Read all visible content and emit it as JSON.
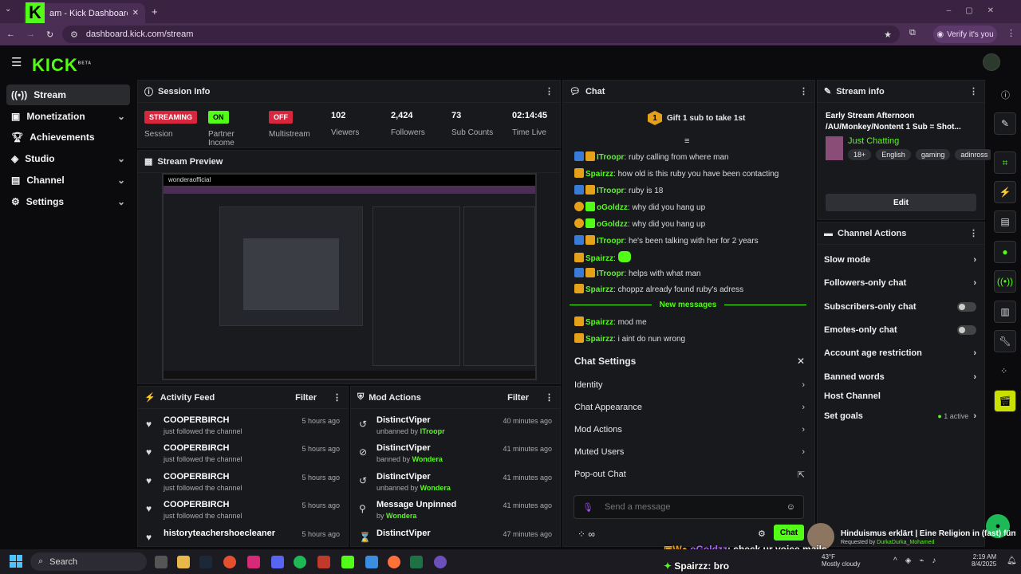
{
  "browser": {
    "tab_title": "am - Kick Dashboard",
    "url": "dashboard.kick.com/stream",
    "verify": "Verify it's you"
  },
  "brand": {
    "logo": "KICK",
    "beta": "BETA"
  },
  "sidebar": {
    "items": [
      {
        "label": "Stream",
        "icon": "stream-icon"
      },
      {
        "label": "Monetization",
        "icon": "money-icon"
      },
      {
        "label": "Achievements",
        "icon": "trophy-icon"
      },
      {
        "label": "Studio",
        "icon": "studio-icon"
      },
      {
        "label": "Channel",
        "icon": "channel-icon"
      },
      {
        "label": "Settings",
        "icon": "gear-icon"
      }
    ]
  },
  "session": {
    "title": "Session Info",
    "session_badge": "STREAMING",
    "session_label": "Session",
    "partner_badge": "ON",
    "partner_label": "Partner Income",
    "multi_badge": "OFF",
    "multi_label": "Multistream",
    "viewers": "102",
    "viewers_label": "Viewers",
    "followers": "2,424",
    "followers_label": "Followers",
    "subs": "73",
    "subs_label": "Sub Counts",
    "time": "02:14:45",
    "time_label": "Time Live"
  },
  "preview": {
    "title": "Stream Preview",
    "channel": "wonderaofficial"
  },
  "activity": {
    "title": "Activity Feed",
    "filter": "Filter",
    "rows": [
      {
        "name": "COOPERBIRCH",
        "sub": "just followed the channel",
        "time": "5 hours ago"
      },
      {
        "name": "COOPERBIRCH",
        "sub": "just followed the channel",
        "time": "5 hours ago"
      },
      {
        "name": "COOPERBIRCH",
        "sub": "just followed the channel",
        "time": "5 hours ago"
      },
      {
        "name": "COOPERBIRCH",
        "sub": "just followed the channel",
        "time": "5 hours ago"
      },
      {
        "name": "historyteachershoecleaner",
        "sub": "",
        "time": "5 hours ago"
      }
    ]
  },
  "mod": {
    "title": "Mod Actions",
    "filter": "Filter",
    "rows": [
      {
        "name": "DistinctViper",
        "sub": "unbanned by",
        "by": "ITroopr",
        "time": "40 minutes ago"
      },
      {
        "name": "DistinctViper",
        "sub": "banned by",
        "by": "Wondera",
        "time": "41 minutes ago"
      },
      {
        "name": "DistinctViper",
        "sub": "unbanned by",
        "by": "Wondera",
        "time": "41 minutes ago"
      },
      {
        "name": "Message Unpinned",
        "sub": "by",
        "by": "Wondera",
        "time": "41 minutes ago"
      },
      {
        "name": "DistinctViper",
        "sub": "",
        "by": "",
        "time": "47 minutes ago"
      }
    ]
  },
  "chat": {
    "title": "Chat",
    "gift": "Gift 1 sub to take 1st",
    "messages": [
      {
        "user": "ITroopr",
        "text": ": ruby calling from where man"
      },
      {
        "user": "Spairzz",
        "text": ": how old is this ruby you have been contacting"
      },
      {
        "user": "ITroopr",
        "text": ": ruby is 18"
      },
      {
        "user": "oGoldzz",
        "text": ": why did you hang up"
      },
      {
        "user": "oGoldzz",
        "text": ": why did you hang up"
      },
      {
        "user": "ITroopr",
        "text": ": he's been talking with her for 2 years"
      },
      {
        "user": "Spairzz",
        "text": ":"
      },
      {
        "user": "ITroopr",
        "text": ": helps with what man"
      },
      {
        "user": "Spairzz",
        "text": ": choppz already found ruby's adress"
      }
    ],
    "new_messages": "New messages",
    "messages2": [
      {
        "user": "Spairzz",
        "text": ": mod me"
      },
      {
        "user": "Spairzz",
        "text": ": i aint do nun wrong"
      }
    ],
    "settings_title": "Chat Settings",
    "settings": [
      "Identity",
      "Chat Appearance",
      "Mod Actions",
      "Muted Users",
      "Pop-out Chat"
    ],
    "placeholder": "Send a message",
    "send": "Chat"
  },
  "stream_info": {
    "title": "Stream info",
    "stream_title": "Early Stream Afternoon /AU/Monkey/Nontent 1 Sub = Shot...",
    "category": "Just Chatting",
    "tags": [
      "18+",
      "English",
      "gaming",
      "adinross"
    ],
    "edit": "Edit"
  },
  "channel_actions": {
    "title": "Channel Actions",
    "rows": [
      {
        "label": "Slow mode",
        "kind": "arrow"
      },
      {
        "label": "Followers-only chat",
        "kind": "arrow"
      },
      {
        "label": "Subscribers-only chat",
        "kind": "toggle"
      },
      {
        "label": "Emotes-only chat",
        "kind": "toggle"
      },
      {
        "label": "Account age restriction",
        "kind": "arrow"
      },
      {
        "label": "Banned words",
        "kind": "arrow"
      },
      {
        "label": "Host Channel",
        "kind": "none"
      },
      {
        "label": "Set goals",
        "kind": "arrow"
      }
    ],
    "goals_active": "1 active"
  },
  "overlay": {
    "video_title": "Hinduismus erklärt | Eine Religion in (fast) fünf M...",
    "requested": "Requested by",
    "requester": "DurkaDurka_Mohamed",
    "line1_user": "oGoldzz",
    "line1_text": ": check ur voice mails",
    "line2_user": "Spairzz",
    "line2_text": ": bro"
  },
  "taskbar": {
    "search": "Search",
    "weather_temp": "43°F",
    "weather": "Mostly cloudy",
    "time": "2:19 AM",
    "date": "8/4/2025"
  }
}
